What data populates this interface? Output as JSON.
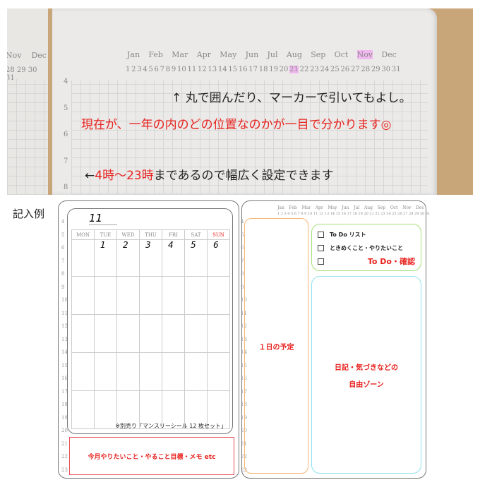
{
  "photo": {
    "prev_months": [
      "Nov",
      "Dec"
    ],
    "prev_days": "28 29 30 31",
    "months": [
      "Jan",
      "Feb",
      "Mar",
      "Apr",
      "May",
      "Jun",
      "Jul",
      "Aug",
      "Sep",
      "Oct",
      "Nov",
      "Dec"
    ],
    "highlighted_month": "Nov",
    "days": [
      "1",
      "2",
      "3",
      "4",
      "5",
      "6",
      "7",
      "8",
      "9",
      "10",
      "11",
      "12",
      "13",
      "14",
      "15",
      "16",
      "17",
      "18",
      "19",
      "20",
      "21",
      "22",
      "23",
      "24",
      "25",
      "26",
      "27",
      "28",
      "29",
      "30",
      "31"
    ],
    "highlighted_day": "21",
    "hours": [
      "4",
      "5",
      "6",
      "7",
      "8"
    ],
    "note1": "↑ 丸で囲んだり、マーカーで引いてもよし。",
    "note2": "現在が、一年の内のどの位置なのかが一目で分かります◎",
    "note3_arrow": "←",
    "note3_red": "4時〜23時",
    "note3_rest": "まであるので幅広く設定できます"
  },
  "example": {
    "label": "記入例",
    "hours": [
      "4",
      "5",
      "6",
      "7",
      "8",
      "9",
      "10",
      "11",
      "12",
      "13",
      "14",
      "15",
      "16",
      "17",
      "18",
      "19",
      "20",
      "21",
      "22",
      "23"
    ],
    "left": {
      "month": "11",
      "weekdays": [
        "MON",
        "TUE",
        "WED",
        "THU",
        "FRI",
        "SAT",
        "SUN"
      ],
      "first_week": [
        "",
        "1",
        "2",
        "3",
        "4",
        "5",
        "6"
      ],
      "sticker_note": "※別売り「マンスリーシール 12 枚セット」",
      "memo": "今月やりたいこと・やること目標・メモ etc"
    },
    "right": {
      "months": [
        "Jan",
        "Feb",
        "Mar",
        "Apr",
        "May",
        "Jun",
        "Jul",
        "Aug",
        "Sep",
        "Oct",
        "Nov",
        "Dec"
      ],
      "days": "1 2 3 4 5 6 7 8 9 10 11 12 13 14 15 16 17 18 19 20 21 22 23 24 25 26 27 28 29 30 31",
      "schedule": "１日の予定",
      "todo_items": [
        "To Do  リスト",
        "ときめくこと・やりたいこと",
        ""
      ],
      "todo_label": "To Do・確認",
      "diary_line1": "日記・気づきなどの",
      "diary_line2": "自由ゾーン"
    }
  },
  "colors": {
    "red": "#e8231f",
    "orange": "#f5b673",
    "green": "#a8e07a",
    "cyan": "#8fe3ee",
    "highlight": "#f0b8ee"
  }
}
